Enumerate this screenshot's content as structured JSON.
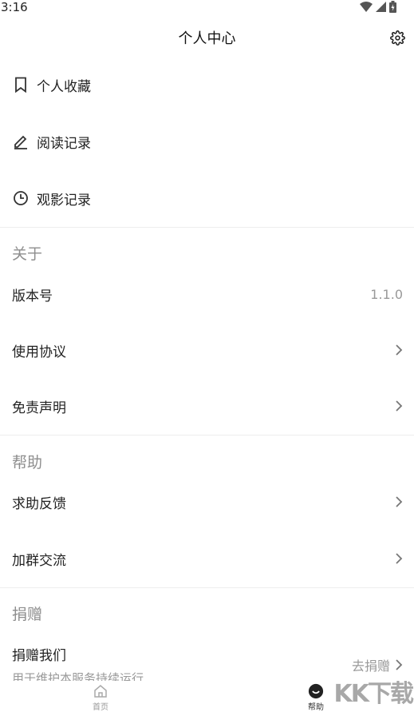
{
  "status_bar": {
    "time": "3:16"
  },
  "header": {
    "title": "个人中心",
    "settings_icon": "gear-icon"
  },
  "personal_items": [
    {
      "label": "个人收藏",
      "icon": "bookmark-icon"
    },
    {
      "label": "阅读记录",
      "icon": "pencil-icon"
    },
    {
      "label": "观影记录",
      "icon": "clock-icon"
    }
  ],
  "about": {
    "title": "关于",
    "version_label": "版本号",
    "version_value": "1.1.0",
    "terms_label": "使用协议",
    "disclaimer_label": "免责声明"
  },
  "help": {
    "title": "帮助",
    "feedback_label": "求助反馈",
    "group_label": "加群交流"
  },
  "donate": {
    "title": "捐赠",
    "donate_label": "捐赠我们",
    "donate_action": "去捐赠",
    "subtext": "用于维护本服务持续运行"
  },
  "bottom_nav": {
    "home_label": "首页",
    "help_label": "帮助"
  },
  "watermark": "KK下载",
  "colors": {
    "divider": "#eeeeee",
    "section_title": "#8e8e8e",
    "secondary_text": "#999999"
  }
}
